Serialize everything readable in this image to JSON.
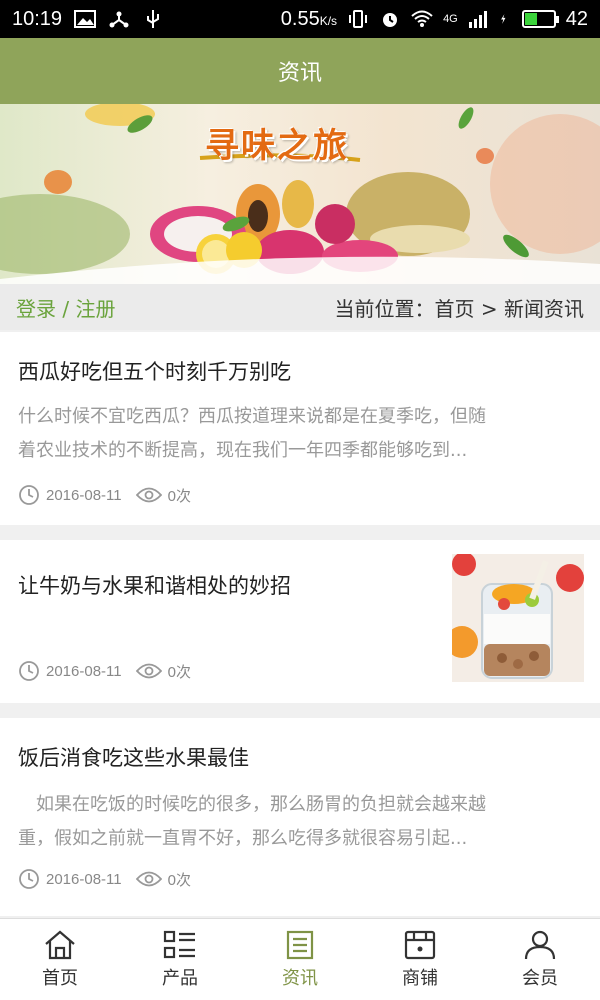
{
  "status_bar": {
    "time": "10:19",
    "speed": "0.55",
    "speed_unit": "K/s",
    "network": "4G",
    "battery": "42",
    "battery_level": 0.42
  },
  "header": {
    "title": "资讯"
  },
  "banner": {
    "title": "寻味之旅"
  },
  "location_bar": {
    "login_link": "登录 / 注册",
    "breadcrumb": "当前位置：首页 > 新闻资讯"
  },
  "articles": [
    {
      "title": "西瓜好吃但五个时刻千万别吃",
      "summary_line1": "什么时候不宜吃西瓜？西瓜按道理来说都是在夏季吃，但随",
      "summary_line2": "着农业技术的不断提高，现在我们一年四季都能够吃到...",
      "date": "2016-08-11",
      "views": "0次"
    },
    {
      "title": "让牛奶与水果和谐相处的妙招",
      "date": "2016-08-11",
      "views": "0次"
    },
    {
      "title": "饭后消食吃这些水果最佳",
      "summary_line1": "　如果在吃饭的时候吃的很多，那么肠胃的负担就会越来越",
      "summary_line2": "重，假如之前就一直胃不好，那么吃得多就很容易引起...",
      "date": "2016-08-11",
      "views": "0次"
    }
  ],
  "bottom_nav": [
    {
      "label": "首页",
      "icon": "home-icon"
    },
    {
      "label": "产品",
      "icon": "list-icon"
    },
    {
      "label": "资讯",
      "icon": "news-icon",
      "active": true
    },
    {
      "label": "商铺",
      "icon": "shop-icon"
    },
    {
      "label": "会员",
      "icon": "user-icon"
    }
  ],
  "colors": {
    "header_bg": "#8fa45a",
    "active_nav": "#7f9346",
    "login_link": "#6aa33c"
  }
}
